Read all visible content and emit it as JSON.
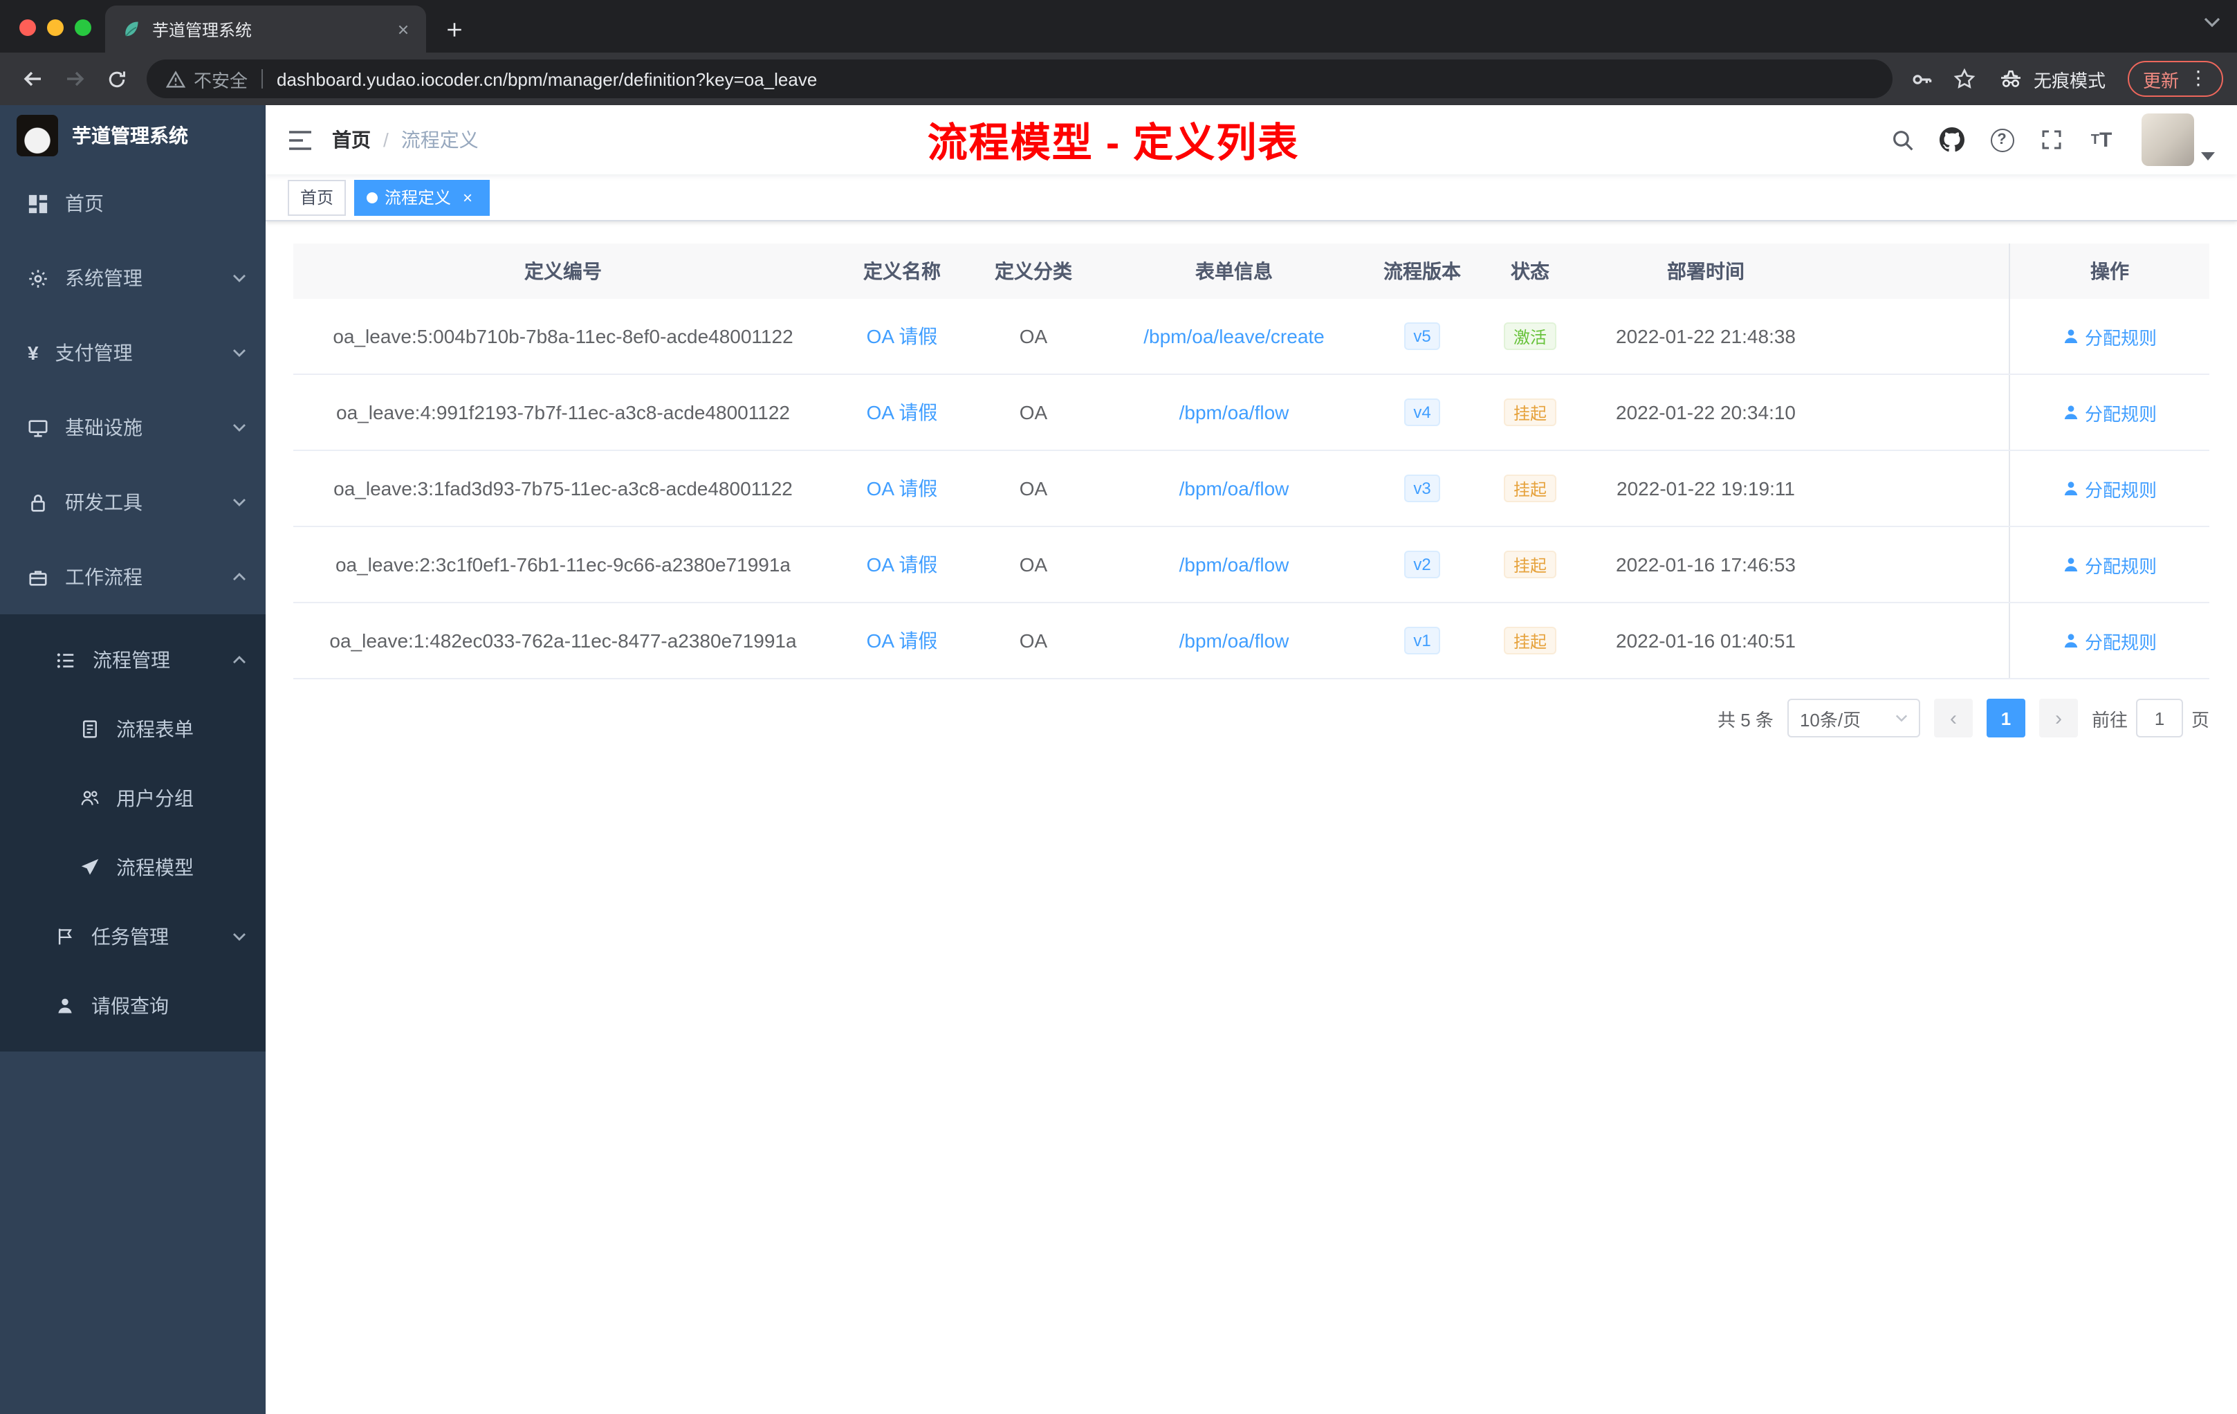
{
  "colors": {
    "primary": "#409eff",
    "success": "#67c23a",
    "warning": "#e6a23c",
    "annotation_red": "#fe0100",
    "sidebar_bg": "#304156",
    "submenu_bg": "#1f2d3d"
  },
  "browser": {
    "tab_title": "芋道管理系统",
    "security_label": "不安全",
    "url": "dashboard.yudao.iocoder.cn/bpm/manager/definition?key=oa_leave",
    "incognito_label": "无痕模式",
    "update_label": "更新"
  },
  "sidebar": {
    "logo_title": "芋道管理系统",
    "items": [
      {
        "label": "首页"
      },
      {
        "label": "系统管理"
      },
      {
        "label": "支付管理"
      },
      {
        "label": "基础设施"
      },
      {
        "label": "研发工具"
      },
      {
        "label": "工作流程"
      }
    ],
    "process_group": {
      "label": "流程管理"
    },
    "process_children": [
      {
        "label": "流程表单"
      },
      {
        "label": "用户分组"
      },
      {
        "label": "流程模型"
      }
    ],
    "task_group": {
      "label": "任务管理"
    },
    "leave_item": {
      "label": "请假查询"
    }
  },
  "navbar": {
    "breadcrumb": {
      "home": "首页",
      "separator": "/",
      "current": "流程定义"
    },
    "annotation": "流程模型 - 定义列表"
  },
  "tags": {
    "home": "首页",
    "active": "流程定义"
  },
  "table": {
    "headers": [
      "定义编号",
      "定义名称",
      "定义分类",
      "表单信息",
      "流程版本",
      "状态",
      "部署时间",
      "操作"
    ],
    "action_label": "分配规则",
    "rows": [
      {
        "id": "oa_leave:5:004b710b-7b8a-11ec-8ef0-acde48001122",
        "name": "OA 请假",
        "category": "OA",
        "form": "/bpm/oa/leave/create",
        "version": "v5",
        "status": "激活",
        "status_type": "success",
        "time": "2022-01-22 21:48:38"
      },
      {
        "id": "oa_leave:4:991f2193-7b7f-11ec-a3c8-acde48001122",
        "name": "OA 请假",
        "category": "OA",
        "form": "/bpm/oa/flow",
        "version": "v4",
        "status": "挂起",
        "status_type": "warning",
        "time": "2022-01-22 20:34:10"
      },
      {
        "id": "oa_leave:3:1fad3d93-7b75-11ec-a3c8-acde48001122",
        "name": "OA 请假",
        "category": "OA",
        "form": "/bpm/oa/flow",
        "version": "v3",
        "status": "挂起",
        "status_type": "warning",
        "time": "2022-01-22 19:19:11"
      },
      {
        "id": "oa_leave:2:3c1f0ef1-76b1-11ec-9c66-a2380e71991a",
        "name": "OA 请假",
        "category": "OA",
        "form": "/bpm/oa/flow",
        "version": "v2",
        "status": "挂起",
        "status_type": "warning",
        "time": "2022-01-16 17:46:53"
      },
      {
        "id": "oa_leave:1:482ec033-762a-11ec-8477-a2380e71991a",
        "name": "OA 请假",
        "category": "OA",
        "form": "/bpm/oa/flow",
        "version": "v1",
        "status": "挂起",
        "status_type": "warning",
        "time": "2022-01-16 01:40:51"
      }
    ]
  },
  "pagination": {
    "total": "共 5 条",
    "page_size": "10条/页",
    "current_page": "1",
    "goto_label": "前往",
    "goto_value": "1",
    "goto_unit": "页"
  }
}
